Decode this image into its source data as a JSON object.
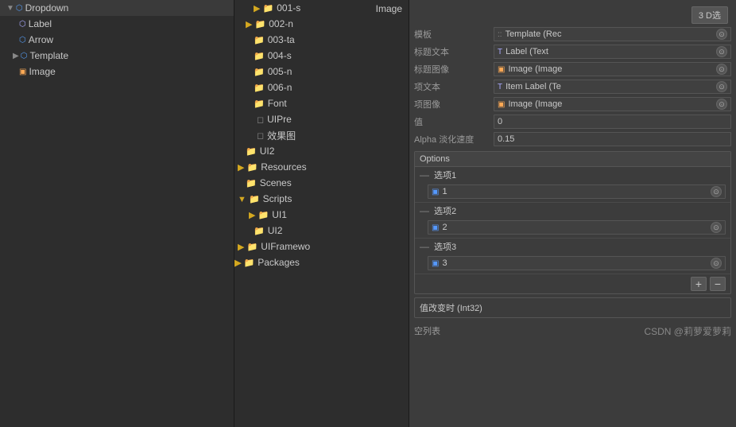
{
  "leftPanel": {
    "items": [
      {
        "id": "dropdown",
        "label": "Dropdown",
        "indent": 0,
        "expanded": true,
        "icon": "cube",
        "selected": false,
        "hasArrow": true
      },
      {
        "id": "label",
        "label": "Label",
        "indent": 1,
        "expanded": false,
        "icon": "label",
        "selected": false,
        "hasArrow": false
      },
      {
        "id": "arrow",
        "label": "Arrow",
        "indent": 1,
        "expanded": false,
        "icon": "cube",
        "selected": false,
        "hasArrow": false
      },
      {
        "id": "template",
        "label": "Template",
        "indent": 1,
        "expanded": false,
        "icon": "cube",
        "selected": false,
        "hasArrow": true
      },
      {
        "id": "image",
        "label": "Image",
        "indent": 1,
        "expanded": false,
        "icon": "image",
        "selected": false,
        "hasArrow": false
      }
    ]
  },
  "middlePanel": {
    "imageLabel": "Image",
    "files": [
      {
        "id": "001",
        "name": "001-s",
        "indent": 0,
        "isFolder": true,
        "hasArrow": false
      },
      {
        "id": "002",
        "name": "002-n",
        "indent": 0,
        "isFolder": true,
        "hasArrow": true
      },
      {
        "id": "003",
        "name": "003-ta",
        "indent": 0,
        "isFolder": true,
        "hasArrow": false
      },
      {
        "id": "004",
        "name": "004-s",
        "indent": 0,
        "isFolder": true,
        "hasArrow": false
      },
      {
        "id": "005",
        "name": "005-n",
        "indent": 0,
        "isFolder": true,
        "hasArrow": false
      },
      {
        "id": "006",
        "name": "006-n",
        "indent": 0,
        "isFolder": true,
        "hasArrow": false
      },
      {
        "id": "font",
        "name": "Font",
        "indent": 0,
        "isFolder": true,
        "hasArrow": false
      },
      {
        "id": "uipre",
        "name": "UIPre",
        "indent": 0,
        "isFolder": false,
        "hasArrow": false
      },
      {
        "id": "effect",
        "name": "效果图",
        "indent": 0,
        "isFolder": false,
        "hasArrow": false
      },
      {
        "id": "ui2a",
        "name": "UI2",
        "indent": -1,
        "isFolder": true,
        "hasArrow": false
      },
      {
        "id": "resources",
        "name": "Resources",
        "indent": -1,
        "isFolder": true,
        "hasArrow": true
      },
      {
        "id": "scenes",
        "name": "Scenes",
        "indent": -1,
        "isFolder": true,
        "hasArrow": false
      },
      {
        "id": "scripts",
        "name": "Scripts",
        "indent": -1,
        "isFolder": true,
        "hasArrow": true,
        "expanded": true
      },
      {
        "id": "ui1",
        "name": "UI1",
        "indent": 0,
        "isFolder": true,
        "hasArrow": true
      },
      {
        "id": "ui2b",
        "name": "UI2",
        "indent": 0,
        "isFolder": true,
        "hasArrow": false
      },
      {
        "id": "uiframework",
        "name": "UIFramewo",
        "indent": -1,
        "isFolder": true,
        "hasArrow": true
      },
      {
        "id": "packages",
        "name": "Packages",
        "indent": -2,
        "isFolder": true,
        "hasArrow": true
      }
    ]
  },
  "inspector": {
    "topButton": "3 D选",
    "fields": [
      {
        "id": "template",
        "label": "模板",
        "icon": "grid",
        "value": "Template (Rec",
        "hasCircle": true
      },
      {
        "id": "caption-text",
        "label": "标题文本",
        "icon": "T",
        "value": "Label (Text",
        "hasCircle": true
      },
      {
        "id": "caption-image",
        "label": "标题图像",
        "icon": "img",
        "value": "Image (Image",
        "hasCircle": true
      },
      {
        "id": "item-text",
        "label": "项文本",
        "icon": "T",
        "value": "Item Label (Te",
        "hasCircle": true
      },
      {
        "id": "item-image",
        "label": "项图像",
        "icon": "img",
        "value": "Image (Image",
        "hasCircle": true
      },
      {
        "id": "value",
        "label": "值",
        "value": "0",
        "hasCircle": false
      },
      {
        "id": "alpha",
        "label": "Alpha 淡化速度",
        "value": "0.15",
        "hasCircle": false
      }
    ],
    "options": {
      "header": "Options",
      "items": [
        {
          "id": "opt1",
          "title": "选项1",
          "value": "1",
          "hasSprite": true
        },
        {
          "id": "opt2",
          "title": "选项2",
          "value": "2",
          "hasSprite": true
        },
        {
          "id": "opt3",
          "title": "选项3",
          "value": "3",
          "hasSprite": true
        }
      ],
      "addLabel": "+",
      "removeLabel": "−"
    },
    "events": [
      {
        "id": "onchange",
        "label": "值改变时 (Int32)"
      },
      {
        "id": "emptylist",
        "label": "空列表"
      }
    ],
    "watermark": "CSDN @莉萝爱萝莉"
  }
}
